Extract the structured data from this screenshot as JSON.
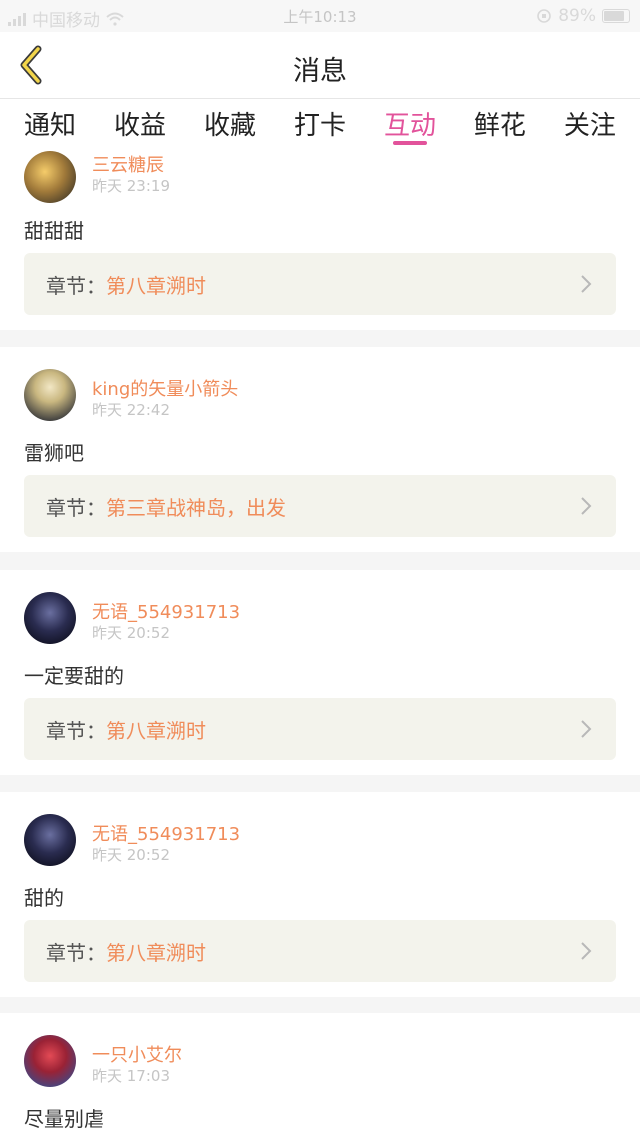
{
  "status_bar": {
    "carrier": "中国移动",
    "time": "上午10:13",
    "battery": "89%"
  },
  "header": {
    "title": "消息",
    "back_icon": "chevron-left-icon"
  },
  "tabs": [
    {
      "label": "通知",
      "active": false
    },
    {
      "label": "收益",
      "active": false
    },
    {
      "label": "收藏",
      "active": false
    },
    {
      "label": "打卡",
      "active": false
    },
    {
      "label": "互动",
      "active": true
    },
    {
      "label": "鲜花",
      "active": false
    },
    {
      "label": "关注",
      "active": false
    }
  ],
  "colors": {
    "accent_pink": "#e2539b",
    "username_orange": "#f08c5a",
    "chapter_bg": "#f3f3ec"
  },
  "messages": [
    {
      "username": "三云糖辰",
      "time": "昨天 23:19",
      "comment": "甜甜甜",
      "chapter_label": "章节：",
      "chapter": "第八章溯时"
    },
    {
      "username": "king的矢量小箭头",
      "time": "昨天 22:42",
      "comment": "雷狮吧",
      "chapter_label": "章节：",
      "chapter": "第三章战神岛，出发"
    },
    {
      "username": "无语_554931713",
      "time": "昨天 20:52",
      "comment": "一定要甜的",
      "chapter_label": "章节：",
      "chapter": "第八章溯时"
    },
    {
      "username": "无语_554931713",
      "time": "昨天 20:52",
      "comment": "甜的",
      "chapter_label": "章节：",
      "chapter": "第八章溯时"
    },
    {
      "username": "一只小艾尔",
      "time": "昨天 17:03",
      "comment": "尽量别虐"
    }
  ]
}
